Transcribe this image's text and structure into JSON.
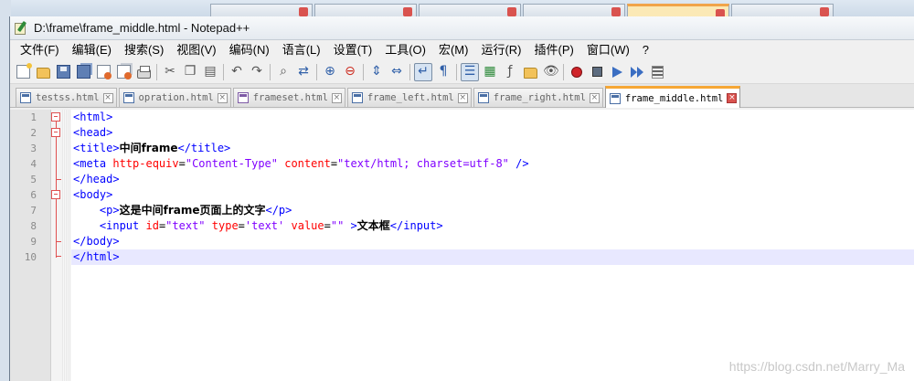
{
  "window": {
    "title": "D:\\frame\\frame_middle.html - Notepad++"
  },
  "menu": [
    "文件(F)",
    "编辑(E)",
    "搜索(S)",
    "视图(V)",
    "编码(N)",
    "语言(L)",
    "设置(T)",
    "工具(O)",
    "宏(M)",
    "运行(R)",
    "插件(P)",
    "窗口(W)",
    "?"
  ],
  "toolbar_icons": [
    "new-file-icon",
    "open-file-icon",
    "save-icon",
    "save-all-icon",
    "close-icon",
    "close-all-icon",
    "print-icon",
    "cut-icon",
    "copy-icon",
    "paste-icon",
    "undo-icon",
    "redo-icon",
    "find-icon",
    "replace-icon",
    "zoom-in-icon",
    "zoom-out-icon",
    "sync-vertical-icon",
    "sync-horizontal-icon",
    "word-wrap-icon",
    "show-all-characters-icon",
    "indent-guide-icon",
    "document-map-icon",
    "function-list-icon",
    "folder-workspace-icon",
    "monitoring-icon",
    "record-macro-icon",
    "stop-recording-icon",
    "play-macro-icon",
    "run-macro-multiple-icon",
    "save-macro-icon"
  ],
  "tabs": [
    {
      "label": "testss.html",
      "icon": "blue"
    },
    {
      "label": "opration.html",
      "icon": "blue"
    },
    {
      "label": "frameset.html",
      "icon": "purple"
    },
    {
      "label": "frame_left.html",
      "icon": "blue"
    },
    {
      "label": "frame_right.html",
      "icon": "blue"
    },
    {
      "label": "frame_middle.html",
      "icon": "blue",
      "active": true
    }
  ],
  "background_tabs": [
    "",
    "",
    "",
    "",
    "",
    ""
  ],
  "editor": {
    "line_numbers": [
      "1",
      "2",
      "3",
      "4",
      "5",
      "6",
      "7",
      "8",
      "9",
      "10"
    ],
    "current_line": 10,
    "lines": [
      [
        {
          "t": "tag",
          "v": "<html>"
        }
      ],
      [
        {
          "t": "tag",
          "v": "<head>"
        }
      ],
      [
        {
          "t": "tag",
          "v": "<title>"
        },
        {
          "t": "txt",
          "v": "中间frame"
        },
        {
          "t": "tag",
          "v": "</title>"
        }
      ],
      [
        {
          "t": "tag",
          "v": "<meta "
        },
        {
          "t": "attr",
          "v": "http-equiv"
        },
        {
          "t": "plain",
          "v": "="
        },
        {
          "t": "str",
          "v": "\"Content-Type\""
        },
        {
          "t": "plain",
          "v": " "
        },
        {
          "t": "attr",
          "v": "content"
        },
        {
          "t": "plain",
          "v": "="
        },
        {
          "t": "str",
          "v": "\"text/html; charset=utf-8\""
        },
        {
          "t": "tag",
          "v": " />"
        }
      ],
      [
        {
          "t": "tag",
          "v": "</head>"
        }
      ],
      [
        {
          "t": "tag",
          "v": "<body>"
        }
      ],
      [
        {
          "t": "plain",
          "v": "    "
        },
        {
          "t": "tag",
          "v": "<p>"
        },
        {
          "t": "txt",
          "v": "这是中间frame页面上的文字"
        },
        {
          "t": "tag",
          "v": "</p>"
        }
      ],
      [
        {
          "t": "plain",
          "v": "    "
        },
        {
          "t": "tag",
          "v": "<input "
        },
        {
          "t": "attr",
          "v": "id"
        },
        {
          "t": "plain",
          "v": "="
        },
        {
          "t": "str",
          "v": "\"text\""
        },
        {
          "t": "plain",
          "v": " "
        },
        {
          "t": "attr",
          "v": "type"
        },
        {
          "t": "plain",
          "v": "="
        },
        {
          "t": "str",
          "v": "'text'"
        },
        {
          "t": "plain",
          "v": " "
        },
        {
          "t": "attr",
          "v": "value"
        },
        {
          "t": "plain",
          "v": "="
        },
        {
          "t": "str",
          "v": "\"\""
        },
        {
          "t": "plain",
          "v": " "
        },
        {
          "t": "tag",
          "v": ">"
        },
        {
          "t": "txt",
          "v": "文本框"
        },
        {
          "t": "tag",
          "v": "</input>"
        }
      ],
      [
        {
          "t": "tag",
          "v": "</body>"
        }
      ],
      [
        {
          "t": "tag",
          "v": "</html>"
        }
      ]
    ]
  },
  "watermark": "https://blog.csdn.net/Marry_Ma"
}
